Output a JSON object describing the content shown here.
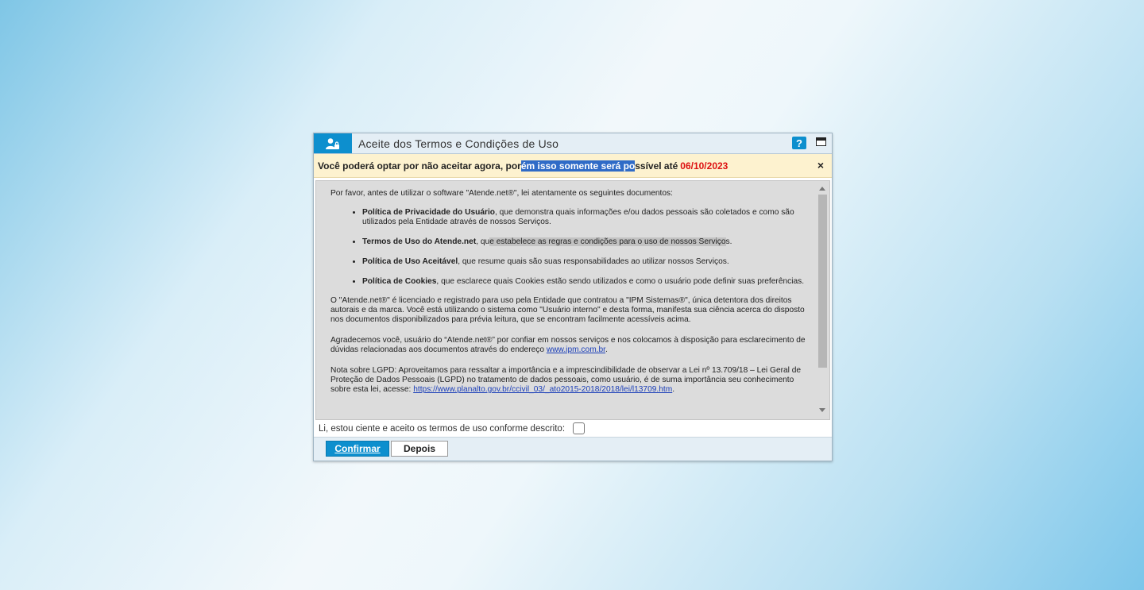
{
  "dialog": {
    "title": "Aceite dos Termos e Condições de Uso",
    "help_label": "?",
    "notice": {
      "part1": "Você poderá optar por não aceitar agora, por",
      "selected": "ém isso somente será po",
      "part2": "ssível até",
      "date": "06/10/2023",
      "close_label": "×"
    },
    "document": {
      "intro": "Por favor, antes de utilizar o software \"Atende.net®\", lei atentamente os seguintes documentos:",
      "items": [
        {
          "title": "Política de Privacidade do Usuário",
          "text": ", que demonstra quais informações e/ou dados pessoais são coletados e como são utilizados pela Entidade através de nossos Serviços."
        },
        {
          "title": "Termos de Uso do Atende.net",
          "text_a": ", qu",
          "text_hl": "e estabelece as regras e condições para o uso de nossos Serviço",
          "text_b": "s."
        },
        {
          "title": "Política de Uso Aceitável",
          "text": ", que resume quais são suas responsabilidades ao utilizar nossos Serviços."
        },
        {
          "title": "Política de Cookies",
          "text": ", que esclarece quais Cookies estão sendo utilizados e como o usuário pode definir suas preferências."
        }
      ],
      "license": "O \"Atende.net®\" é licenciado e registrado para uso pela Entidade que contratou  a \"IPM Sistemas®\", única detentora dos direitos autorais e da marca. Você está utilizando o sistema como \"Usuário interno\" e desta forma, manifesta sua ciência acerca do disposto nos documentos disponibilizados para prévia leitura, que se encontram facilmente acessíveis acima.",
      "thanks_text": "Agradecemos você, usuário do “Atende.net®” por confiar em nossos serviços e nos colocamos à disposição para esclarecimento de dúvidas relacionadas aos documentos através do endereço ",
      "thanks_link": "www.ipm.com.br",
      "thanks_end": ".",
      "lgpd_text": "Nota sobre LGPD: Aproveitamos para ressaltar a importância e a imprescindibilidade de observar a Lei nº 13.709/18 – Lei Geral de Proteção de Dados Pessoais (LGPD) no tratamento de dados pessoais, como usuário, é de suma importância seu conhecimento sobre esta lei, acesse: ",
      "lgpd_link": "https://www.planalto.gov.br/ccivil_03/_ato2015-2018/2018/lei/l13709.htm",
      "lgpd_end": "."
    },
    "consent_label": "Li, estou ciente e aceito os termos de uso conforme descrito:",
    "buttons": {
      "confirm": "Confirmar",
      "later": "Depois"
    }
  }
}
